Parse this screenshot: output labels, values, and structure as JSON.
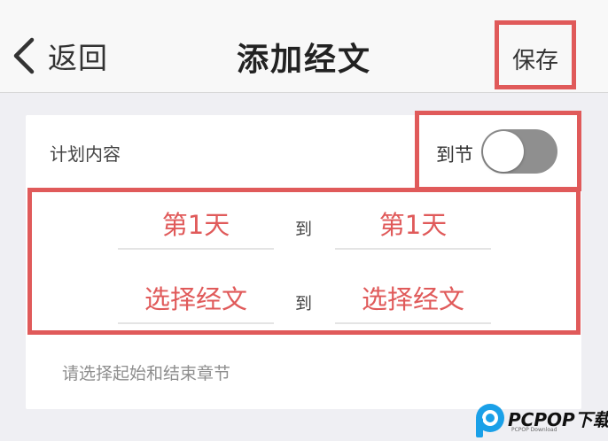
{
  "navbar": {
    "back_label": "返回",
    "title": "添加经文",
    "save_label": "保存"
  },
  "plan": {
    "section_label": "计划内容",
    "toggle_label": "到节",
    "toggle_on": false,
    "range": {
      "day_start": "第1天",
      "day_end": "第1天",
      "verse_start": "选择经文",
      "verse_end": "选择经文",
      "to_word": "到"
    },
    "hint": "请选择起始和结束章节"
  },
  "watermark": {
    "text": "PCPOP下载",
    "sub": "PCPOP Download"
  },
  "colors": {
    "accent": "#e05a5a",
    "background": "#efeff3",
    "switch_off": "#8f8f8f"
  }
}
